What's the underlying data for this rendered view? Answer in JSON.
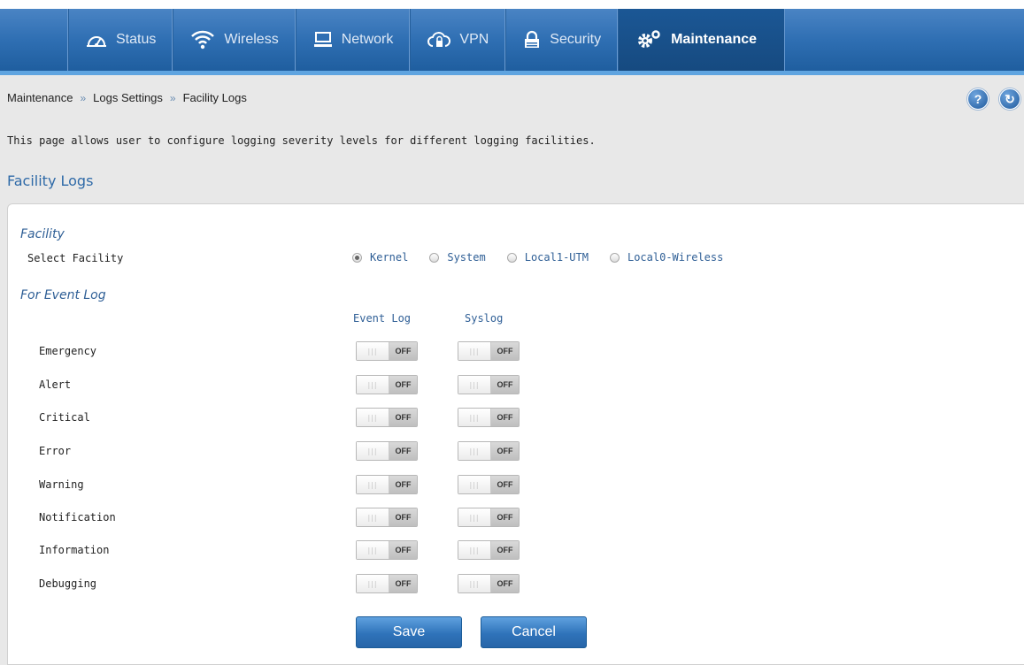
{
  "nav": {
    "items": [
      {
        "label": "Status",
        "icon": "dashboard-gauge-icon"
      },
      {
        "label": "Wireless",
        "icon": "wifi-icon"
      },
      {
        "label": "Network",
        "icon": "monitor-icon"
      },
      {
        "label": "VPN",
        "icon": "cloud-lock-icon"
      },
      {
        "label": "Security",
        "icon": "padlock-icon"
      },
      {
        "label": "Maintenance",
        "icon": "gears-icon",
        "active": true
      }
    ]
  },
  "breadcrumb": {
    "items": [
      "Maintenance",
      "Logs Settings",
      "Facility Logs"
    ],
    "separator": "»"
  },
  "help": {
    "help_glyph": "?",
    "refresh_glyph": "↻"
  },
  "description": "This page allows user to configure logging severity levels for different logging facilities.",
  "section_title": "Facility Logs",
  "facility": {
    "title": "Facility",
    "select_label": "Select Facility",
    "options": [
      "Kernel",
      "System",
      "Local1-UTM",
      "Local0-Wireless"
    ],
    "selected": "Kernel"
  },
  "event_log": {
    "title": "For Event Log",
    "columns": [
      "Event Log",
      "Syslog"
    ],
    "rows": [
      {
        "label": "Emergency",
        "event_log": "OFF",
        "syslog": "OFF"
      },
      {
        "label": "Alert",
        "event_log": "OFF",
        "syslog": "OFF"
      },
      {
        "label": "Critical",
        "event_log": "OFF",
        "syslog": "OFF"
      },
      {
        "label": "Error",
        "event_log": "OFF",
        "syslog": "OFF"
      },
      {
        "label": "Warning",
        "event_log": "OFF",
        "syslog": "OFF"
      },
      {
        "label": "Notification",
        "event_log": "OFF",
        "syslog": "OFF"
      },
      {
        "label": "Information",
        "event_log": "OFF",
        "syslog": "OFF"
      },
      {
        "label": "Debugging",
        "event_log": "OFF",
        "syslog": "OFF"
      }
    ]
  },
  "actions": {
    "save_label": "Save",
    "cancel_label": "Cancel"
  },
  "colors": {
    "nav_bg": "#2f6fb3",
    "accent": "#2f6aa8",
    "button": "#2f73ba"
  }
}
